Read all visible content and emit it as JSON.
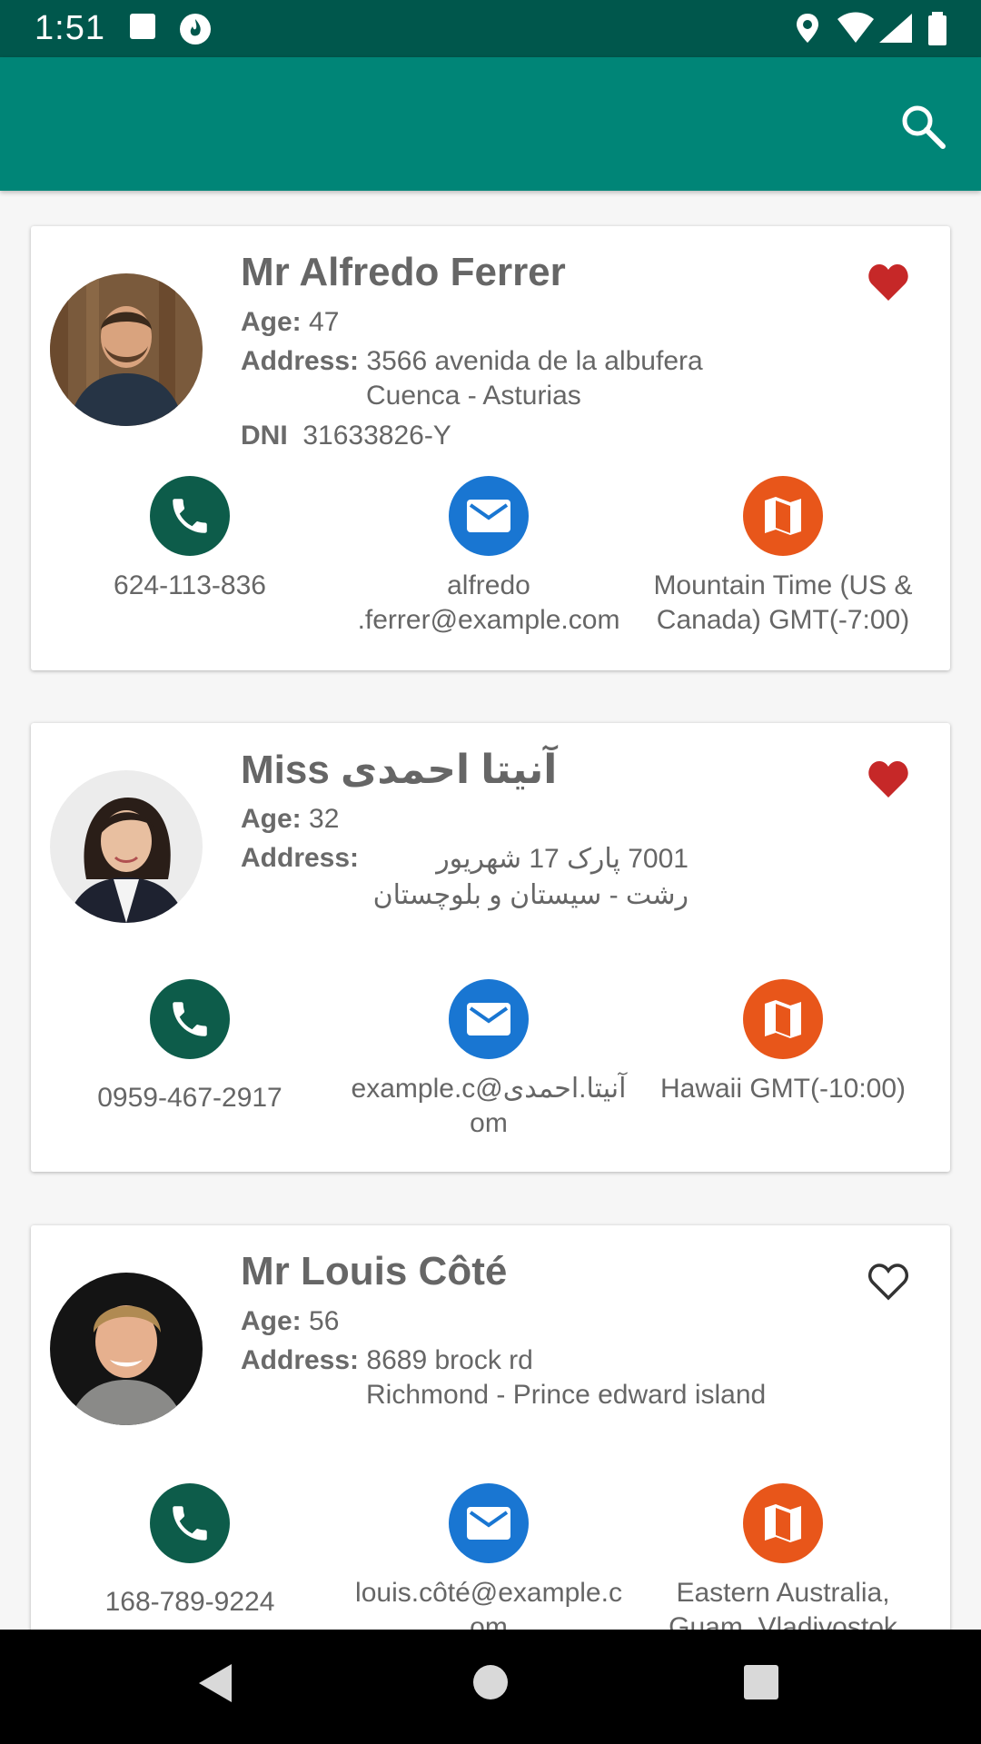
{
  "status_bar": {
    "time": "1:51"
  },
  "app_bar": {
    "search_icon": "search-icon"
  },
  "colors": {
    "status_bar": "#00574c",
    "app_bar": "#008577",
    "phone": "#0d5c4a",
    "email": "#1976d2",
    "map": "#e8561a",
    "heart": "#c62828"
  },
  "contacts": [
    {
      "name": "Mr Alfredo Ferrer",
      "favorite": true,
      "age_label": "Age:",
      "age": "47",
      "address_label": "Address:",
      "address_line1": "3566 avenida de la albufera",
      "address_line2": "Cuenca - Asturias",
      "dni_label": "DNI",
      "dni": "31633826-Y",
      "phone": "624-113-836",
      "email_line1": "alfredo",
      "email_line2": ".ferrer@example.com",
      "timezone_line1": "Mountain Time (US &",
      "timezone_line2": "Canada) GMT(-7:00)"
    },
    {
      "name": "Miss آنیتا احمدی",
      "favorite": true,
      "age_label": "Age:",
      "age": "32",
      "address_label": "Address:",
      "address_line1": "7001 پارک 17 شهریور",
      "address_line2": "رشت - سیستان و بلوچستان",
      "phone": "0959-467-2917",
      "email_line1": "example.c@آنیتا.احمدی",
      "email_line2": "om",
      "timezone_line1": "Hawaii GMT(-10:00)",
      "timezone_line2": ""
    },
    {
      "name": "Mr Louis Côté",
      "favorite": false,
      "age_label": "Age:",
      "age": "56",
      "address_label": "Address:",
      "address_line1": "8689 brock rd",
      "address_line2": "Richmond - Prince edward island",
      "phone": "168-789-9224",
      "email_line1": "louis.côté@example.c",
      "email_line2": "om",
      "timezone_line1": "Eastern Australia,",
      "timezone_line2": "Guam, Vladivostok"
    }
  ]
}
